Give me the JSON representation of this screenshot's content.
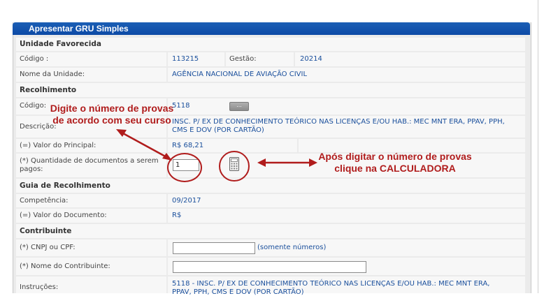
{
  "title": "Apresentar GRU Simples",
  "unidade": {
    "section_title": "Unidade Favorecida",
    "codigo_label": "Código :",
    "codigo_value": "113215",
    "gestao_label": "Gestão:",
    "gestao_value": "20214",
    "nome_label": "Nome da Unidade:",
    "nome_value": "AGÊNCIA NACIONAL DE AVIAÇÃO CIVIL"
  },
  "recolhimento": {
    "section_title": "Recolhimento",
    "codigo_label": "Código:",
    "codigo_value": "5118",
    "lookup_button": "...",
    "descricao_label": "Descrição:",
    "descricao_line1": "INSC. P/ EX DE CONHECIMENTO TEÓRICO NAS LICENÇAS E/OU HAB.: MEC MNT ERA, PPAV, PPH,",
    "descricao_line2": "CMS E DOV (POR CARTÃO)",
    "valor_label": "(=) Valor do Principal:",
    "valor_value": "R$ 68,21",
    "quantidade_label_1": "(*) Quantidade de documentos a serem",
    "quantidade_label_2": "pagos:",
    "quantidade_value": "1"
  },
  "guia": {
    "section_title": "Guia de Recolhimento",
    "competencia_label": "Competência:",
    "competencia_value": "09/2017",
    "valor_doc_label": "(=) Valor do Documento:",
    "valor_doc_value": "R$"
  },
  "contribuinte": {
    "section_title": "Contribuinte",
    "cnpj_label": "(*) CNPJ ou CPF:",
    "cnpj_value": "",
    "cnpj_hint": "(somente números)",
    "nome_label": "(*) Nome do Contribuinte:",
    "nome_value": "",
    "instrucoes_label": "Instruções:",
    "instrucoes_line1": "5118  -  INSC. P/ EX DE CONHECIMENTO TEÓRICO NAS LICENÇAS E/OU HAB.: MEC MNT ERA,",
    "instrucoes_line2": "PPAV, PPH, CMS E DOV (POR CARTÃO)"
  },
  "annotations": {
    "left_line1": "Digite o número de provas",
    "left_line2": "de acordo com seu curso",
    "right_line1": "Após digitar o número de provas",
    "right_line2": "clique na CALCULADORA"
  },
  "colors": {
    "title_bar": "#0d4aa6",
    "value_text": "#1a4f9c",
    "annotation": "#b01c1c"
  },
  "icons": {
    "calculator": "calculator-icon",
    "lookup": "ellipsis-icon"
  }
}
